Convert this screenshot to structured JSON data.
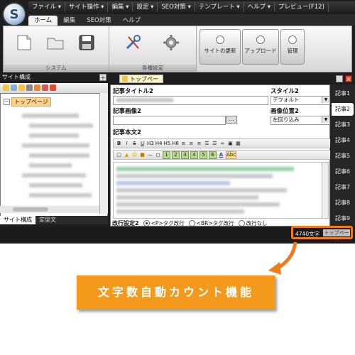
{
  "menubar": {
    "items": [
      "ファイル ▾",
      "サイト操作 ▾",
      "編集 ▾",
      "設定 ▾",
      "SEO対策 ▾",
      "テンプレート ▾",
      "ヘルプ ▾",
      "プレビュー(F12)"
    ]
  },
  "ribbon_tabs": [
    "ホーム",
    "編集",
    "SEO対策",
    "ヘルプ"
  ],
  "ribbon": {
    "group_system_label": "システム",
    "group_settings_label": "各種設定",
    "btn_site_update": "サイトの更新",
    "btn_upload": "アップロード",
    "btn_manage": "管理"
  },
  "left_pane": {
    "title": "サイト構成",
    "root_label": "トップページ",
    "tabs": [
      "サイト構成",
      "定型文"
    ]
  },
  "editor": {
    "doc_tab": "トップページ",
    "title_label": "記事タイトル2",
    "image_label": "記事画像2",
    "body_label": "記事本文2",
    "style_label": "スタイル2",
    "style_value": "デフォルト",
    "image_pos_label": "画像位置2",
    "image_pos_value": "左回り込み",
    "linebreak_label": "改行設定2",
    "linebreak_options": [
      "<P>タグ改行",
      "<BR>タグ改行",
      "改行なし"
    ],
    "toolbar1": [
      "B",
      "I",
      "S",
      "U",
      "H3",
      "H4",
      "H5",
      "H6"
    ],
    "toolbar2_nums": [
      "1",
      "2",
      "3",
      "4",
      "5",
      "6"
    ],
    "toolbar_abc": "Abc"
  },
  "article_tabs": [
    "記事1",
    "記事2",
    "記事3",
    "記事4",
    "記事5",
    "記事6",
    "記事7",
    "記事8",
    "記事9"
  ],
  "status": {
    "char_count": "4740文字",
    "page": "トップページ"
  },
  "callout": {
    "text": "文字数自動カウント機能"
  },
  "colors": {
    "accent_orange": "#f39a1d",
    "highlight_orange": "#f07b1a",
    "chrome_dark": "#1e1e1e"
  }
}
